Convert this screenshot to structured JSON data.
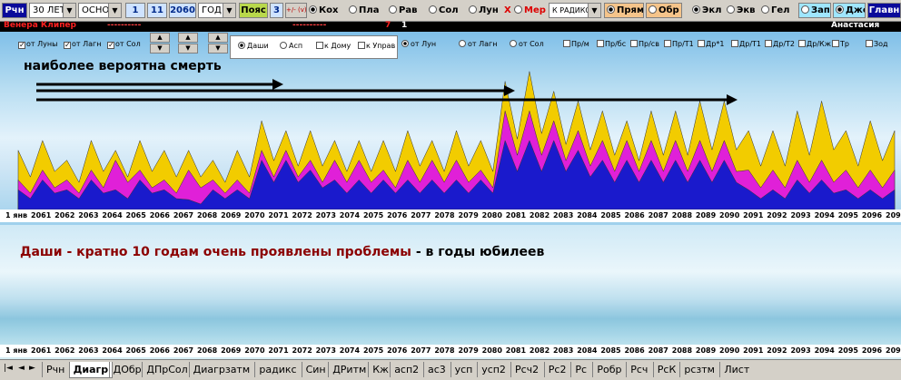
{
  "toolbar": {
    "rchn_label": "Рчн",
    "period_value": "30 ЛЕТ",
    "mode_value": "ОСНОВН",
    "field_day": "1",
    "field_month": "11",
    "field_year": "2060",
    "unit_value": "ГОД",
    "belts_label": "Пояс",
    "belts_count": "3",
    "plusminus_label": "+/- (v)",
    "planets": [
      "Кох",
      "Пла",
      "Рав",
      "Сол",
      "Лун",
      "Мер"
    ],
    "planet_x_mark": "Х",
    "radix_value": "К РАДИКСУ",
    "direct_label": "Прям",
    "reverse_label": "Обр",
    "coord_options": [
      "Экл",
      "Экв",
      "Гел"
    ],
    "west_label": "Зап",
    "jyotish_label": "Джот",
    "main_label": "Главн"
  },
  "info_strip": {
    "left_name": "Венера Клипер",
    "right_name": "Анастасия",
    "dashes": "----------",
    "num_a": "7",
    "num_b": "1"
  },
  "chart_controls": {
    "checkboxes_top": [
      "от Луны",
      "от Лагн",
      "от Сол"
    ],
    "mode_radios": [
      "Даши",
      "Асп"
    ],
    "to_checks": [
      "к Дому",
      "к Управ"
    ],
    "from_radios": [
      "от Лун",
      "от Лагн",
      "от Сол"
    ],
    "aspect_checks": [
      "Пр/м",
      "Пр/бс",
      "Пр/св",
      "Пр/Т1",
      "Др*1",
      "Др/Т1",
      "Др/Т2",
      "Др/Кж",
      "Тр",
      "Зод"
    ]
  },
  "chart_note": "наиболее вероятна смерть",
  "lower_note_red": "Даши - кратно 10 годам очень проявлены проблемы",
  "lower_note_black": " - в годы юбилеев",
  "axis_first_label": "1 янв",
  "colors": {
    "blue": "#1a1acc",
    "yellow": "#f2cc00",
    "magenta": "#e020d8",
    "green": "#43c843",
    "navy": "#3a3a9a"
  },
  "chart_data": {
    "type": "area",
    "categories": [
      "2061",
      "2062",
      "2063",
      "2064",
      "2065",
      "2066",
      "2067",
      "2068",
      "2069",
      "2070",
      "2071",
      "2072",
      "2073",
      "2074",
      "2075",
      "2076",
      "2077",
      "2078",
      "2079",
      "2080",
      "2081",
      "2082",
      "2083",
      "2084",
      "2085",
      "2086",
      "2087",
      "2088",
      "2089",
      "2090",
      "2091",
      "2092",
      "2093",
      "2094",
      "2095",
      "2096",
      "2097"
    ],
    "lower_categories": [
      "2061",
      "2062",
      "2063",
      "2064",
      "2065",
      "2066",
      "2067",
      "2068",
      "2069",
      "2070",
      "2071",
      "2072",
      "2073",
      "2074",
      "2075",
      "2076",
      "2077",
      "2078",
      "2079",
      "2080",
      "2081",
      "2082",
      "2083",
      "2084",
      "2085",
      "2086",
      "2087",
      "2088",
      "2089",
      "2090",
      "2091",
      "2092",
      "2093",
      "2094",
      "2095",
      "2096",
      "2097"
    ],
    "series": [
      {
        "values": [
          2,
          3,
          2,
          3,
          2,
          3,
          2,
          1,
          2,
          2,
          5,
          5,
          4,
          3,
          3,
          3,
          3,
          3,
          3,
          3,
          7,
          7,
          7,
          6,
          5,
          5,
          5,
          5,
          5,
          5,
          2,
          2,
          3,
          3,
          2,
          2,
          2
        ]
      },
      {
        "values": [
          6,
          7,
          5,
          7,
          6,
          7,
          6,
          6,
          5,
          6,
          9,
          8,
          8,
          7,
          7,
          7,
          8,
          7,
          8,
          7,
          13,
          14,
          12,
          11,
          10,
          9,
          10,
          10,
          11,
          11,
          8,
          8,
          10,
          11,
          8,
          9,
          8
        ]
      },
      {
        "values": [
          3,
          4,
          3,
          4,
          5,
          4,
          3,
          4,
          3,
          3,
          6,
          6,
          5,
          5,
          5,
          4,
          5,
          5,
          5,
          4,
          10,
          10,
          9,
          8,
          7,
          7,
          7,
          7,
          7,
          7,
          4,
          4,
          5,
          5,
          4,
          4,
          4
        ]
      }
    ],
    "ylim": [
      0,
      16
    ]
  },
  "tabs": [
    "Рчн",
    "Диагр",
    "ДОбр",
    "ДПрСол",
    "Диагрзатм",
    "радикс",
    "Син",
    "ДРитм",
    "Кж",
    "асп2",
    "ас3",
    "усп",
    "усп2",
    "Рсч2",
    "Рс2",
    "Рс",
    "Робр",
    "Рсч",
    "РсК",
    "рсзтм",
    "Лист"
  ],
  "active_tab": "Диагр"
}
